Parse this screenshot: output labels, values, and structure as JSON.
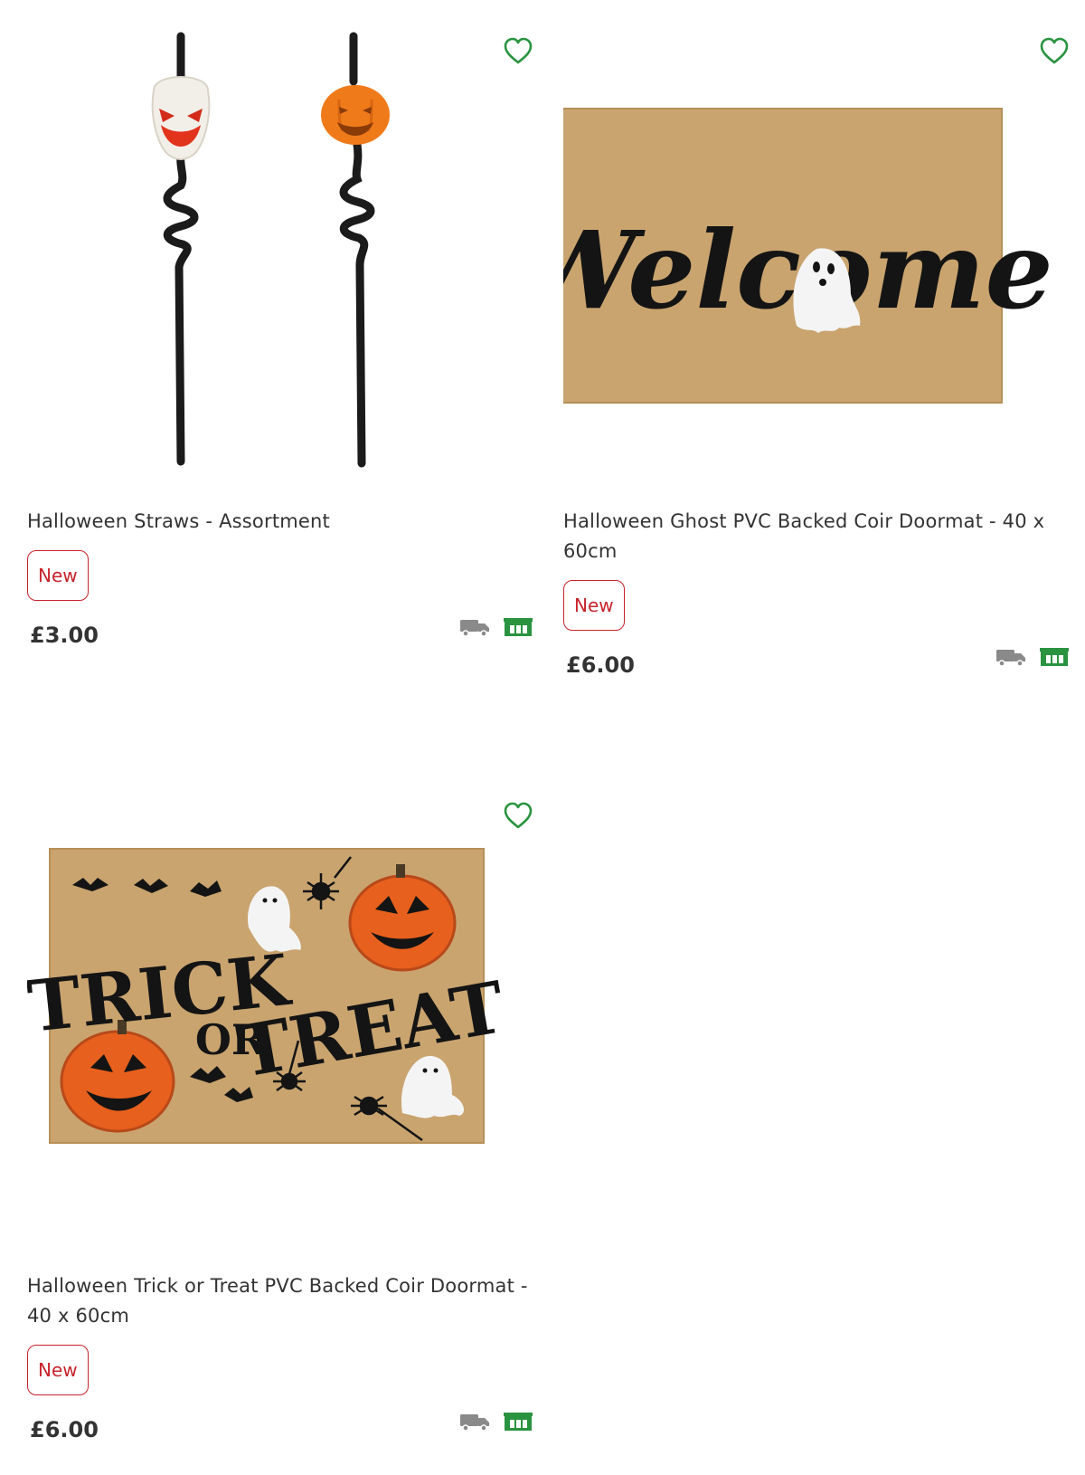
{
  "products": [
    {
      "title": "Halloween Straws - Assortment",
      "badge": "New",
      "price": "£3.00",
      "image_icon": "halloween-straws-image",
      "favourite_icon": "heart-icon",
      "delivery_icon": "delivery-truck-icon",
      "collection_icon": "store-collection-icon"
    },
    {
      "title": "Halloween Ghost PVC Backed Coir Doormat - 40 x 60cm",
      "badge": "New",
      "price": "£6.00",
      "image_icon": "ghost-welcome-doormat-image",
      "mat_text": "Welcome",
      "favourite_icon": "heart-icon",
      "delivery_icon": "delivery-truck-icon",
      "collection_icon": "store-collection-icon"
    },
    {
      "title": "Halloween Trick or Treat PVC Backed Coir Doormat - 40 x 60cm",
      "badge": "New",
      "price": "£6.00",
      "image_icon": "trick-or-treat-doormat-image",
      "mat_text_1": "TRICK",
      "mat_text_2": "OR",
      "mat_text_3": "TREAT",
      "favourite_icon": "heart-icon",
      "delivery_icon": "delivery-truck-icon",
      "collection_icon": "store-collection-icon"
    }
  ],
  "colors": {
    "accent_green": "#2a9340",
    "badge_red": "#c8232c",
    "icon_grey": "#8a8a8a",
    "coir": "#c9a46f"
  }
}
